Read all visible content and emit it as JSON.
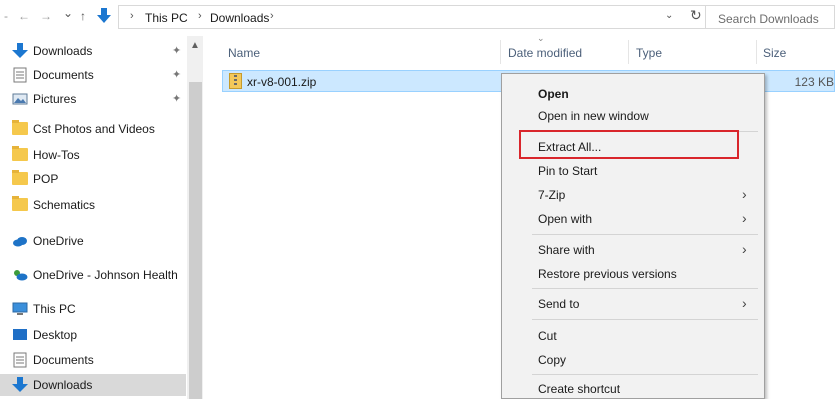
{
  "address_bar": {
    "nav": {
      "back": "←",
      "forward": "→",
      "recent": "⌄",
      "up": "↑"
    },
    "crumbs": [
      "This PC",
      "Downloads"
    ],
    "search_placeholder": "Search Downloads"
  },
  "sidebar": {
    "items": [
      {
        "label": "Downloads",
        "icon": "download-icon",
        "pinned": true
      },
      {
        "label": "Documents",
        "icon": "document-icon",
        "pinned": true
      },
      {
        "label": "Pictures",
        "icon": "pictures-icon",
        "pinned": true
      },
      {
        "label": "Cst Photos and Videos",
        "icon": "folder-icon"
      },
      {
        "label": "How-Tos",
        "icon": "folder-icon"
      },
      {
        "label": "POP",
        "icon": "folder-icon"
      },
      {
        "label": "Schematics",
        "icon": "folder-icon"
      },
      {
        "label": "OneDrive",
        "icon": "onedrive-icon"
      },
      {
        "label": "OneDrive - Johnson Health",
        "icon": "onedrive-business-icon"
      },
      {
        "label": "This PC",
        "icon": "computer-icon"
      },
      {
        "label": "Desktop",
        "icon": "desktop-icon"
      },
      {
        "label": "Documents",
        "icon": "document-icon"
      },
      {
        "label": "Downloads",
        "icon": "download-icon",
        "selected": true
      }
    ]
  },
  "columns": {
    "name": "Name",
    "date": "Date modified",
    "type": "Type",
    "size": "Size"
  },
  "files": [
    {
      "name": "xr-v8-001.zip",
      "size": "123 KB",
      "icon": "zip-icon",
      "selected": true
    }
  ],
  "context_menu": {
    "groups": [
      [
        {
          "label": "Open",
          "bold": true
        },
        {
          "label": "Open in new window"
        }
      ],
      [
        {
          "label": "Extract All...",
          "highlighted": true
        },
        {
          "label": "Pin to Start"
        },
        {
          "label": "7-Zip",
          "submenu": true
        },
        {
          "label": "Open with",
          "submenu": true
        }
      ],
      [
        {
          "label": "Share with",
          "submenu": true
        },
        {
          "label": "Restore previous versions"
        }
      ],
      [
        {
          "label": "Send to",
          "submenu": true
        }
      ],
      [
        {
          "label": "Cut"
        },
        {
          "label": "Copy"
        }
      ],
      [
        {
          "label": "Create shortcut"
        }
      ]
    ]
  },
  "colors": {
    "selection": "#cce8ff",
    "highlight_box": "#d9262c",
    "menu_bg": "#f2f2f2",
    "folder": "#f5c84c"
  }
}
